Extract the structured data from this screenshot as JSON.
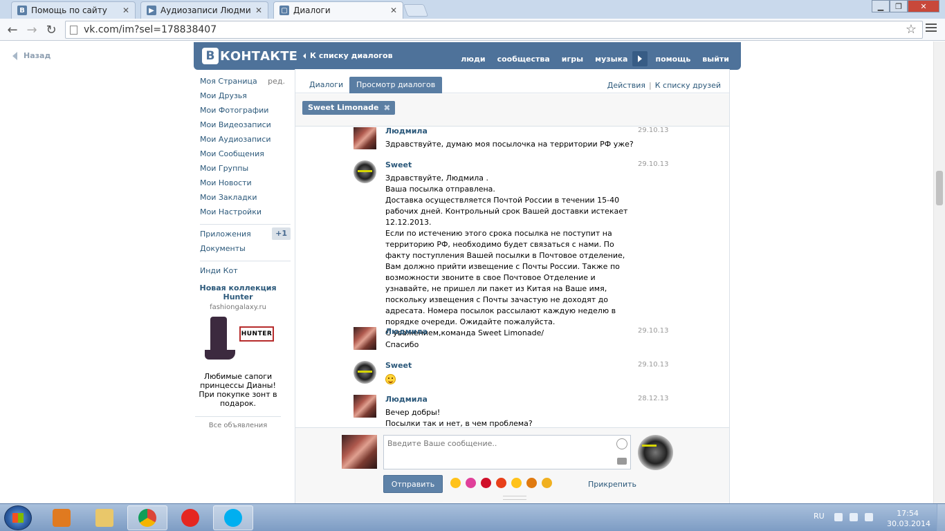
{
  "browser": {
    "tabs": [
      {
        "title": "Помощь по сайту",
        "favicon": "В"
      },
      {
        "title": "Аудиозаписи Людмил",
        "favicon": "▶"
      },
      {
        "title": "Диалоги",
        "favicon": "▢"
      }
    ],
    "url": "vk.com/im?sel=178838407"
  },
  "page": {
    "back_label": "Назад",
    "logo_letter": "В",
    "logo_text": "КОНТАКТЕ",
    "back_to_dialogs": "К списку диалогов",
    "top_nav": [
      "люди",
      "сообщества",
      "игры",
      "музыка",
      "помощь",
      "выйти"
    ]
  },
  "left_menu": {
    "items": [
      {
        "label": "Моя Страница",
        "extra": "ред."
      },
      {
        "label": "Мои Друзья"
      },
      {
        "label": "Мои Фотографии"
      },
      {
        "label": "Мои Видеозаписи"
      },
      {
        "label": "Мои Аудиозаписи"
      },
      {
        "label": "Мои Сообщения"
      },
      {
        "label": "Мои Группы"
      },
      {
        "label": "Мои Новости"
      },
      {
        "label": "Мои Закладки"
      },
      {
        "label": "Мои Настройки"
      }
    ],
    "apps_label": "Приложения",
    "apps_badge": "+1",
    "docs_label": "Документы",
    "indi_label": "Инди Кот"
  },
  "ad": {
    "title": "Новая коллекция Hunter",
    "domain": "fashiongalaxy.ru",
    "logo_text": "HUNTER",
    "text": "Любимые сапоги принцессы Дианы! При покупке зонт в подарок.",
    "all_ads": "Все объявления"
  },
  "dialog": {
    "tabs": [
      "Диалоги",
      "Просмотр диалогов"
    ],
    "actions": "Действия",
    "friends_link": "К списку друзей",
    "peer": "Sweet Limonade",
    "messages": [
      {
        "author": "Людмила",
        "date": "29.10.13",
        "text": "Здравствуйте, думаю моя посылочка на территории РФ уже?"
      },
      {
        "author": "Sweet",
        "date": "29.10.13",
        "text": "Здравствуйте, Людмила .\nВаша посылка отправлена.\nДоставка осуществляется Почтой России в течении 15-40 рабочих дней. Контрольный срок Вашей доставки истекает 12.12.2013.\nЕсли по истечению этого срока посылка не поступит на территорию РФ, необходимо будет связаться с нами. По факту поступления Вашей посылки в Почтовое отделение, Вам должно прийти извещение с Почты России. Также по возможности звоните в свое Почтовое Отделение и узнавайте, не пришел ли пакет из Китая на Ваше имя, поскольку извещения с Почты зачастую не доходят до адресата. Номера посылок рассылают каждую неделю в порядке очереди. Ожидайте пожалуйста.\nС уважением,команда Sweet Limonade/"
      },
      {
        "author": "Людмила",
        "date": "29.10.13",
        "text": "Спасибо"
      },
      {
        "author": "Sweet",
        "date": "29.10.13",
        "text": ""
      },
      {
        "author": "Людмила",
        "date": "28.12.13",
        "text": "Вечер добры!\nПосылки так и нет, в чем проблема?"
      }
    ],
    "input_placeholder": "Введите Ваше сообщение..",
    "send_label": "Отправить",
    "attach_label": "Прикрепить",
    "emoji_colors": [
      "#ffc21a",
      "#e0409a",
      "#d0102a",
      "#e8401a",
      "#ffc21a",
      "#e07a10",
      "#f0b020"
    ]
  },
  "taskbar": {
    "lang": "RU",
    "time": "17:54",
    "date": "30.03.2014"
  }
}
